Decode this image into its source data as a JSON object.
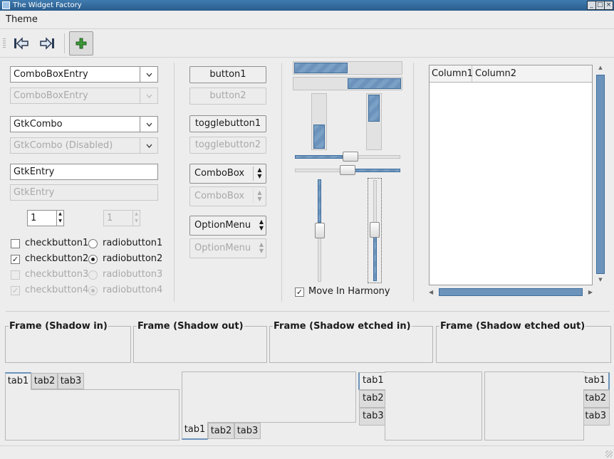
{
  "window": {
    "title": "The Widget Factory"
  },
  "menu": {
    "theme": "Theme"
  },
  "col1": {
    "combo_entry": "ComboBoxEntry",
    "combo_entry_disabled": "ComboBoxEntry",
    "gtk_combo": "GtkCombo",
    "gtk_combo_disabled": "GtkCombo (Disabled)",
    "gtk_entry": "GtkEntry",
    "gtk_entry_disabled": "GtkEntry",
    "spin_value": "1",
    "spin_disabled_value": "1",
    "checks": [
      {
        "label": "checkbutton1",
        "checked": false
      },
      {
        "label": "checkbutton2",
        "checked": true
      },
      {
        "label": "checkbutton3",
        "checked": false
      },
      {
        "label": "checkbutton4",
        "checked": true
      }
    ],
    "radios": [
      {
        "label": "radiobutton1",
        "selected": false
      },
      {
        "label": "radiobutton2",
        "selected": true
      },
      {
        "label": "radiobutton3",
        "selected": false
      },
      {
        "label": "radiobutton4",
        "selected": true
      }
    ],
    "check_mark": "✓"
  },
  "col2": {
    "button1": "button1",
    "button2": "button2",
    "togglebutton1": "togglebutton1",
    "togglebutton2": "togglebutton2",
    "combobox": "ComboBox",
    "combobox_disabled": "ComboBox",
    "optionmenu": "OptionMenu",
    "optionmenu_disabled": "OptionMenu"
  },
  "col3": {
    "progress_h1": 0.5,
    "progress_h2": 0.5,
    "progress_v1": 0.45,
    "progress_v2": 0.5,
    "hscale1": 0.53,
    "hscale2": 0.5,
    "vscale1": 0.5,
    "vscale2": 0.5,
    "harmony_label": "Move In Harmony",
    "harmony_checked": true
  },
  "tree": {
    "columns": [
      "Column1",
      "Column2"
    ]
  },
  "frames": [
    {
      "title": "Frame (Shadow in)"
    },
    {
      "title": "Frame (Shadow out)"
    },
    {
      "title": "Frame (Shadow etched in)"
    },
    {
      "title": "Frame (Shadow etched out)"
    }
  ],
  "tabs": [
    "tab1",
    "tab2",
    "tab3"
  ],
  "icons": {
    "goto_first": "goto-first-icon",
    "goto_last": "goto-last-icon",
    "add": "add-icon"
  },
  "colors": {
    "accent": "#6c93bb",
    "title_bar": "#2a5c8c"
  }
}
